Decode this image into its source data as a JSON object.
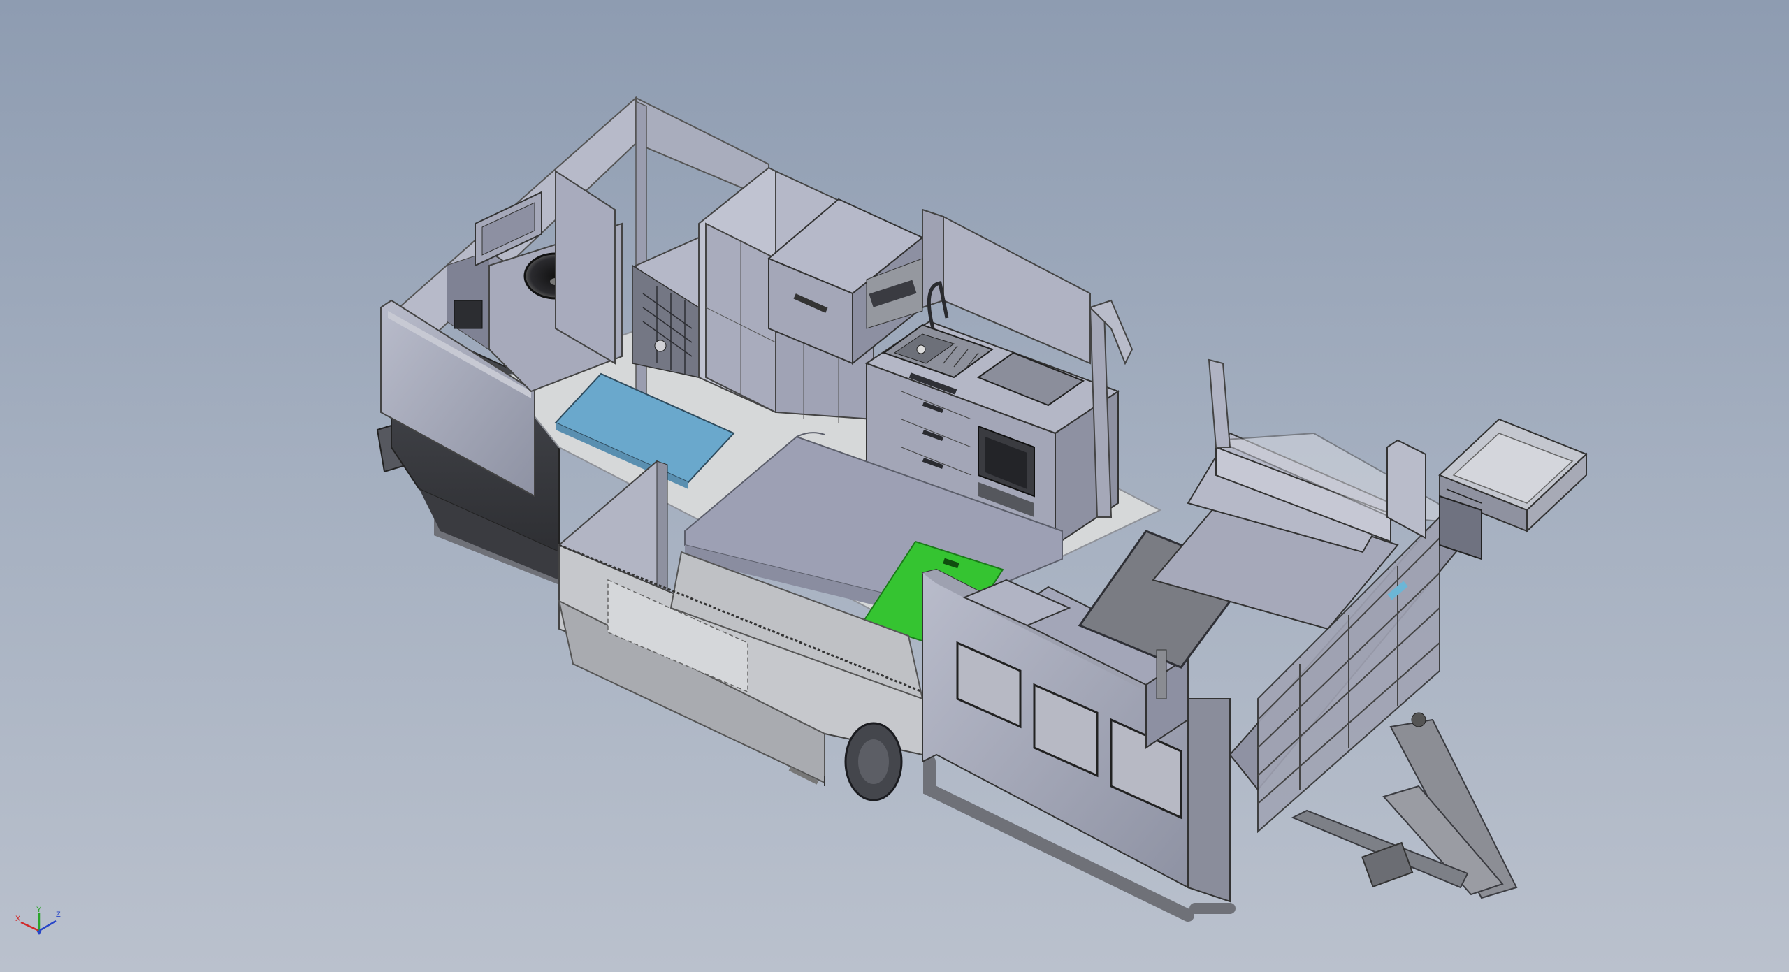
{
  "viewport": {
    "background_top": "#8e9cb1",
    "background_bottom": "#bac1cd"
  },
  "model": {
    "highlight_colors": {
      "blue_cushion": "#6aa8cc",
      "green_face": "#35c431"
    }
  },
  "triad": {
    "x_label": "X",
    "y_label": "Y",
    "z_label": "Z",
    "x_color": "#d12828",
    "y_color": "#2aa52a",
    "z_color": "#2846c8"
  }
}
